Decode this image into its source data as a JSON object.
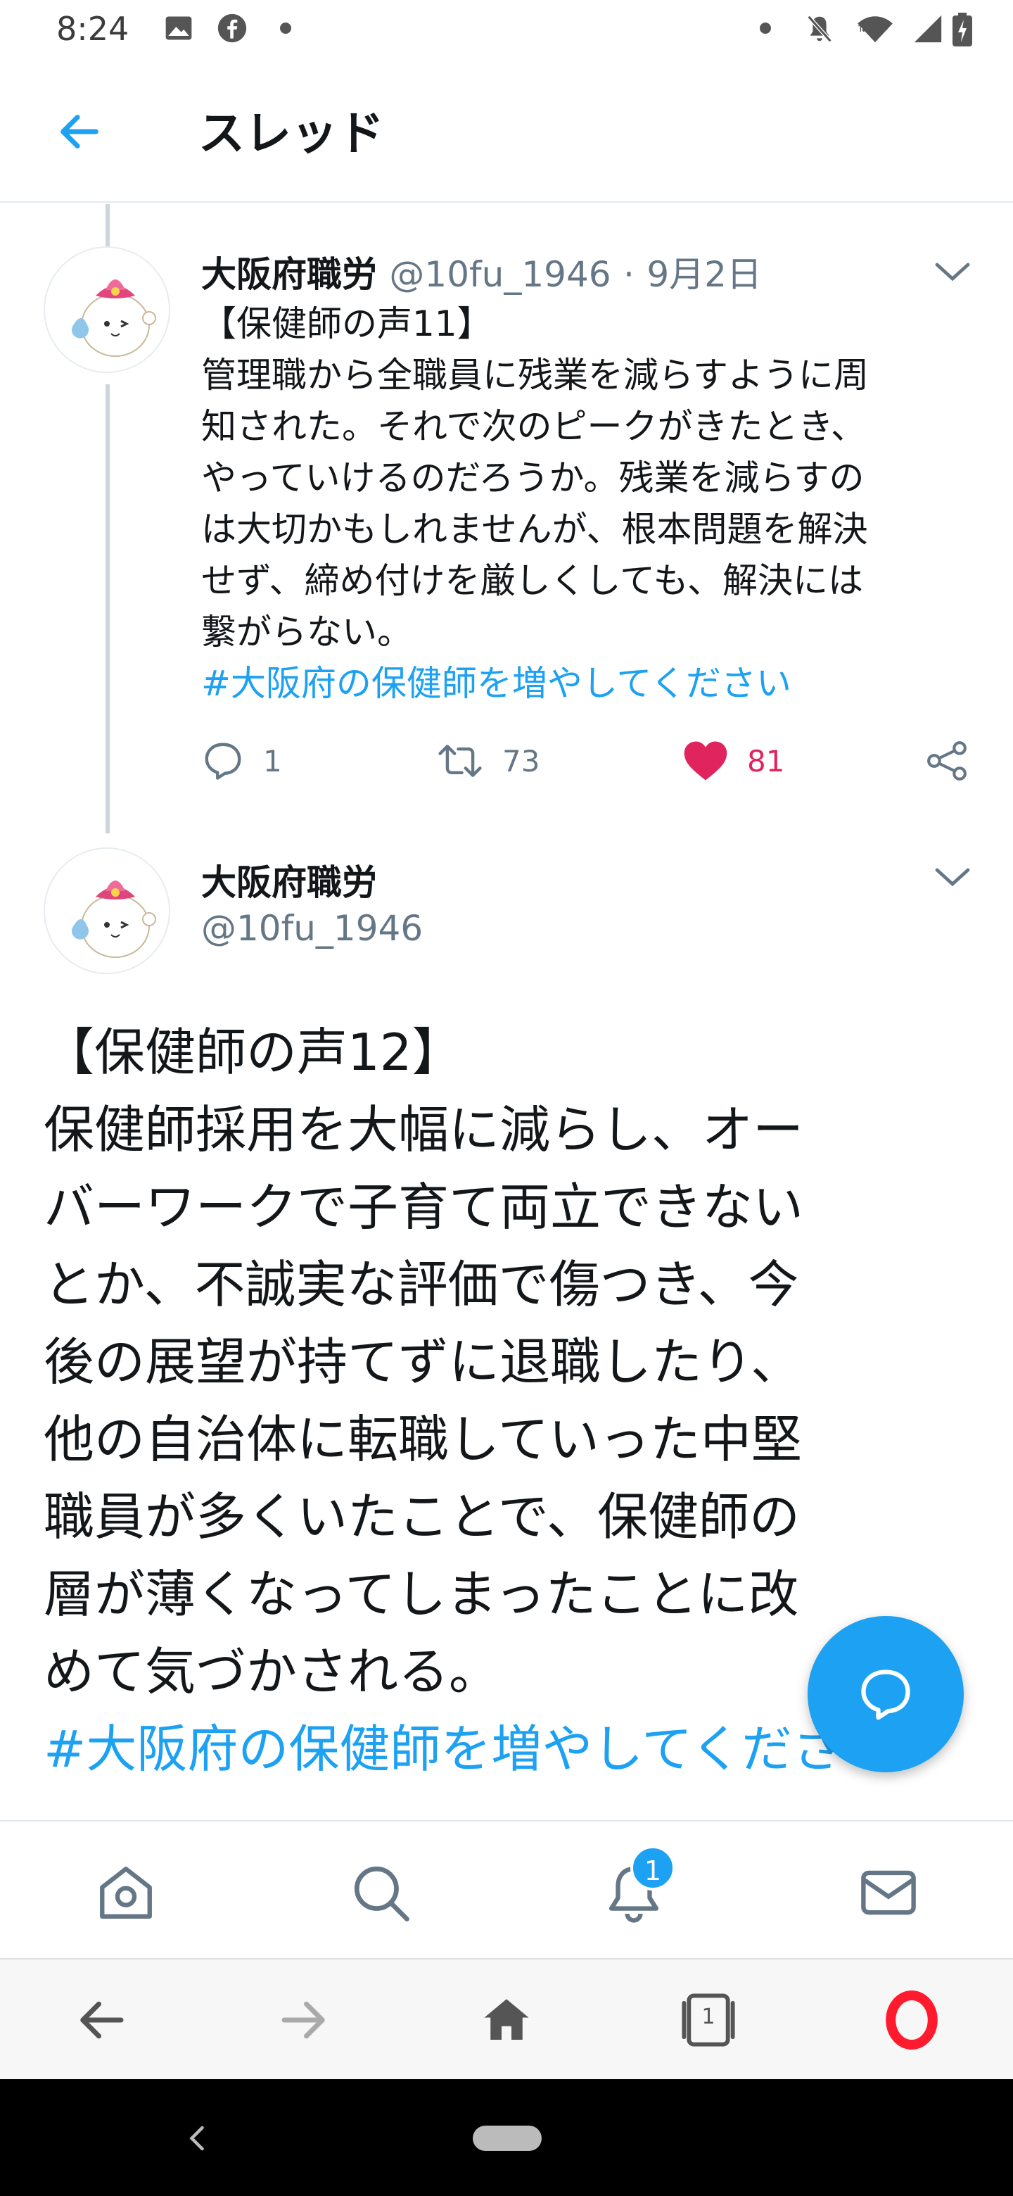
{
  "status_bar": {
    "time": "8:24"
  },
  "header": {
    "title": "スレッド"
  },
  "tweet1": {
    "name": "大阪府職労",
    "handle": "@10fu_1946",
    "separator": "·",
    "date": "9月2日",
    "lines": [
      "【保健師の声11】",
      "管理職から全職員に残業を減らすように周",
      "知された。それで次のピークがきたとき、",
      "やっていけるのだろうか。残業を減らすの",
      "は大切かもしれませんが、根本問題を解決",
      "せず、締め付けを厳しくしても、解決には",
      "繋がらない。"
    ],
    "hashtag": "#大阪府の保健師を増やしてください",
    "reply_count": "1",
    "retweet_count": "73",
    "like_count": "81"
  },
  "tweet2": {
    "name": "大阪府職労",
    "handle": "@10fu_1946",
    "lines": [
      "【保健師の声12】",
      "保健師採用を大幅に減らし、オー",
      "バーワークで子育て両立できない",
      "とか、不誠実な評価で傷つき、今",
      "後の展望が持てずに退職したり、",
      "他の自治体に転職していった中堅",
      "職員が多くいたことで、保健師の",
      "層が薄くなってしまったことに改",
      "めて気づかされる。"
    ],
    "hashtag": "#大阪府の保健師を増やしてください"
  },
  "tabbar": {
    "notification_badge": "1"
  },
  "browser": {
    "tab_count": "1"
  },
  "colors": {
    "accent": "#1da1f2",
    "like": "#e0245e",
    "text": "#14171a",
    "muted": "#657786"
  }
}
